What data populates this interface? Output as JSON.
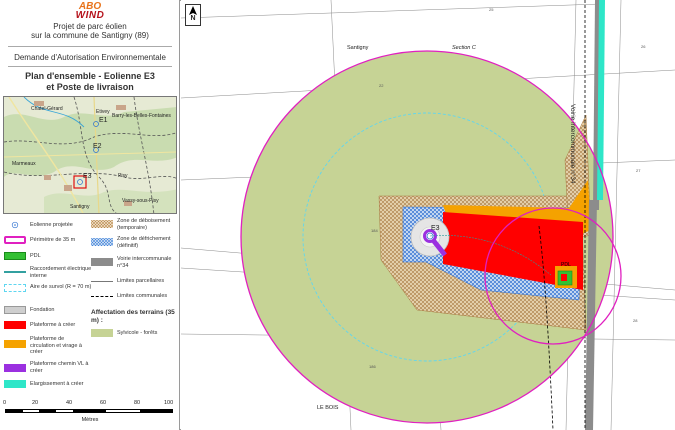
{
  "header": {
    "logo_top": "ABO",
    "logo_bottom": "WIND",
    "project_line1": "Projet de parc éolien",
    "project_line2": "sur la commune de Santigny (89)",
    "request": "Demande d'Autorisation Environnementale",
    "title_line1": "Plan d'ensemble - Eolienne E3",
    "title_line2": "et Poste de livraison"
  },
  "inset": {
    "places": {
      "chatel": "Chatel-Gérard",
      "etivey": "Etivey",
      "barry": "Barry-les-Belles-Fontaines",
      "marmeaux": "Marmeaux",
      "pisy": "Pisy",
      "santigny": "Santigny",
      "vassy": "Vassy-sous-Pisy"
    },
    "turbines": [
      "E1",
      "E2",
      "E3"
    ]
  },
  "legend": {
    "eolienne": "Eolienne projetée",
    "perimetre": "Périmètre de 35 m",
    "pdl": "PDL",
    "raccordement": "Raccordement électrique interne",
    "aire": "Aire de survol (R = 70 m)",
    "fondation": "Fondation",
    "plateforme": "Plateforme à créer",
    "circulation": "Plateforme de circulation et virage à créer",
    "chemin": "Plateforme chemin VL à créer",
    "elargissement": "Elargissement à créer",
    "deboisement": "Zone de déboisement (temporaire)",
    "defrichement": "Zone de défrichement (définitif)",
    "voirie": "Voirie intercommunale n°34",
    "limites_parcellaires": "Limites parcellaires",
    "limites_communales": "Limites communales",
    "affectation_title": "Affectation des terrains (35 m) :",
    "sylvicole": "Sylvicole - forêts"
  },
  "scale": {
    "ticks": [
      "0",
      "20",
      "40",
      "60",
      "80",
      "100"
    ],
    "unit": "Mètres"
  },
  "map": {
    "north": "N",
    "santigny": "Santigny",
    "section": "Section C",
    "le_bois": "LE BOIS",
    "road": "Voirie intercommunale n°34",
    "turbine": "E3",
    "pdl": "PDL",
    "parcels": [
      "25",
      "22",
      "184",
      "186",
      "26",
      "27",
      "28"
    ]
  },
  "colors": {
    "perimetre": "#e020c0",
    "sylvicole": "#c6d395",
    "plateforme": "#ff0000",
    "circulation": "#f5a200",
    "chemin": "#9b30e0",
    "elargissement": "#2ee6c8",
    "pdl": "#33c033",
    "voirie": "#8c8c8c",
    "aire": "#5fd6f0",
    "deboisement": "#b8864a",
    "defrichement": "#3a7fd8"
  }
}
